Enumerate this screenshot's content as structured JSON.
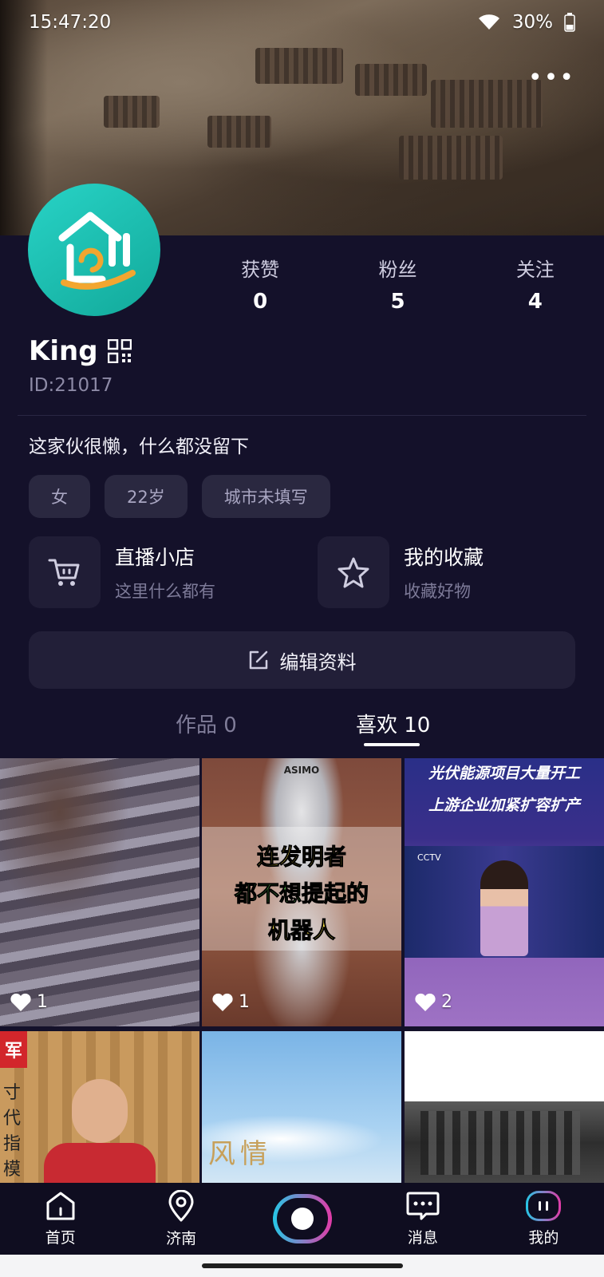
{
  "status": {
    "time": "15:47:20",
    "battery": "30%"
  },
  "profile": {
    "name": "King",
    "id_text": "ID:21017",
    "bio": "这家伙很懒，什么都没留下",
    "tags": [
      "女",
      "22岁",
      "城市未填写"
    ]
  },
  "stats": [
    {
      "label": "获赞",
      "value": "0"
    },
    {
      "label": "粉丝",
      "value": "5"
    },
    {
      "label": "关注",
      "value": "4"
    }
  ],
  "features": {
    "shop": {
      "title": "直播小店",
      "subtitle": "这里什么都有"
    },
    "favorites": {
      "title": "我的收藏",
      "subtitle": "收藏好物"
    }
  },
  "edit_button": "编辑资料",
  "tabs": {
    "works": "作品 0",
    "likes": "喜欢 10"
  },
  "grid": {
    "items": [
      {
        "likes": "1"
      },
      {
        "likes": "1",
        "overlay": [
          "连发明者",
          "都不想提起的",
          "机器人"
        ],
        "badge": "ASIMO"
      },
      {
        "likes": "2",
        "overlay": [
          "光伏能源项目大量开工",
          "上游企业加紧扩容扩产"
        ],
        "badge": "CCTV"
      },
      {
        "side_text": "军",
        "side_vertical": "寸代指模"
      },
      {
        "overlay": [
          "风情"
        ]
      },
      {}
    ]
  },
  "nav": {
    "home": "首页",
    "city": "济南",
    "messages": "消息",
    "mine": "我的"
  },
  "colors": {
    "accent_teal": "#1fc0b4",
    "background": "#14112a"
  }
}
